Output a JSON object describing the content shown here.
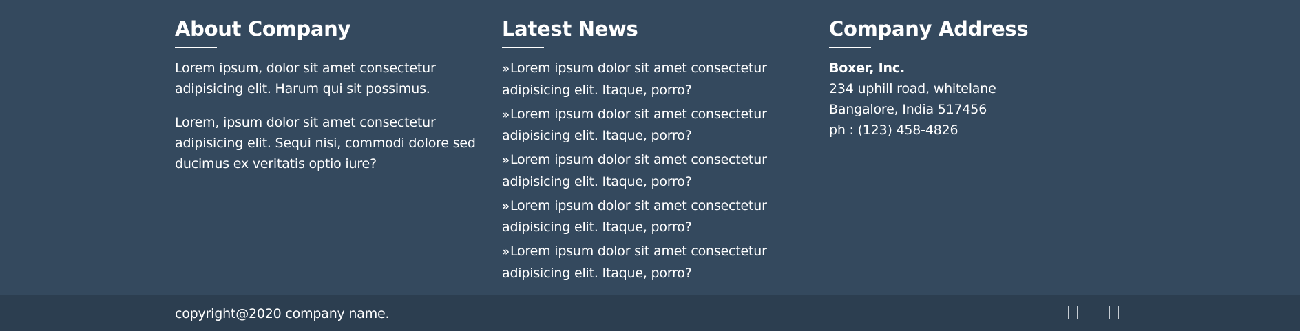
{
  "about": {
    "title": "About Company",
    "paragraphs": [
      "Lorem ipsum, dolor sit amet consectetur adipisicing elit. Harum qui sit possimus.",
      "Lorem, ipsum dolor sit amet consectetur adipisicing elit. Sequi nisi, commodi dolore sed ducimus ex veritatis optio iure?"
    ]
  },
  "news": {
    "title": "Latest News",
    "chevron": "»",
    "items": [
      "Lorem ipsum dolor sit amet consectetur adipisicing elit. Itaque, porro?",
      "Lorem ipsum dolor sit amet consectetur adipisicing elit. Itaque, porro?",
      "Lorem ipsum dolor sit amet consectetur adipisicing elit. Itaque, porro?",
      "Lorem ipsum dolor sit amet consectetur adipisicing elit. Itaque, porro?",
      "Lorem ipsum dolor sit amet consectetur adipisicing elit. Itaque, porro?"
    ]
  },
  "address": {
    "title": "Company Address",
    "company": "Boxer, Inc.",
    "line1": "234 uphill road, whitelane",
    "line2": "Bangalore, India 517456",
    "phone": "ph : (123) 458-4826"
  },
  "footer": {
    "copyright": "copyright@2020 company name.",
    "social_icons": [
      "social-icon-1",
      "social-icon-2",
      "social-icon-3"
    ]
  },
  "colors": {
    "top_background": "#34495e",
    "bottom_background": "#2c3e50",
    "text": "#ffffff"
  }
}
